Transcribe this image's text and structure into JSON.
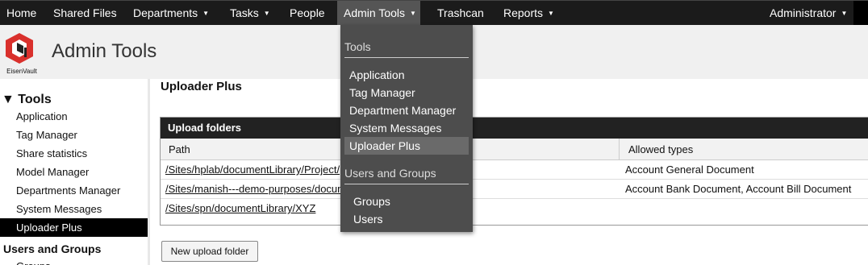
{
  "nav": {
    "items": [
      {
        "label": "Home",
        "caret": false
      },
      {
        "label": "Shared Files",
        "caret": false
      },
      {
        "label": "Departments",
        "caret": true
      },
      {
        "label": "Tasks",
        "caret": true
      },
      {
        "label": "People",
        "caret": false
      },
      {
        "label": "Admin Tools",
        "caret": true
      },
      {
        "label": "Trashcan",
        "caret": false
      },
      {
        "label": "Reports",
        "caret": true
      }
    ],
    "user": "Administrator",
    "caret_glyph": "▼"
  },
  "header": {
    "logo_text": "EisenVault",
    "title": "Admin Tools"
  },
  "sidebar": {
    "section_tools": "▼ Tools",
    "items": [
      "Application",
      "Tag Manager",
      "Share statistics",
      "Model Manager",
      "Departments Manager",
      "System Messages",
      "Uploader Plus"
    ],
    "selected": "Uploader Plus",
    "section_users": "Users and Groups",
    "users_items": [
      "Groups"
    ]
  },
  "main": {
    "title": "Uploader Plus",
    "panel_title": "Upload folders",
    "columns": [
      "Path",
      "Allowed types"
    ],
    "rows": [
      {
        "path": "/Sites/hplab/documentLibrary/Project/",
        "types": "Account General Document"
      },
      {
        "path": "/Sites/manish---demo-purposes/docum",
        "types": "Account Bank Document, Account Bill Document"
      },
      {
        "path": "/Sites/spn/documentLibrary/XYZ",
        "types": ""
      }
    ],
    "new_button": "New upload folder"
  },
  "dropdown": {
    "section_tools": "Tools",
    "tools_items": [
      "Application",
      "Tag Manager",
      "Department Manager",
      "System Messages",
      "Uploader Plus"
    ],
    "hovered": "Uploader Plus",
    "section_users": "Users and Groups",
    "users_items": [
      "Groups",
      "Users"
    ]
  },
  "colors": {
    "nav_bg": "#1b1b1b",
    "nav_active": "#555555",
    "dropdown_bg": "#4d4d4d",
    "logo_red": "#d9302c"
  }
}
